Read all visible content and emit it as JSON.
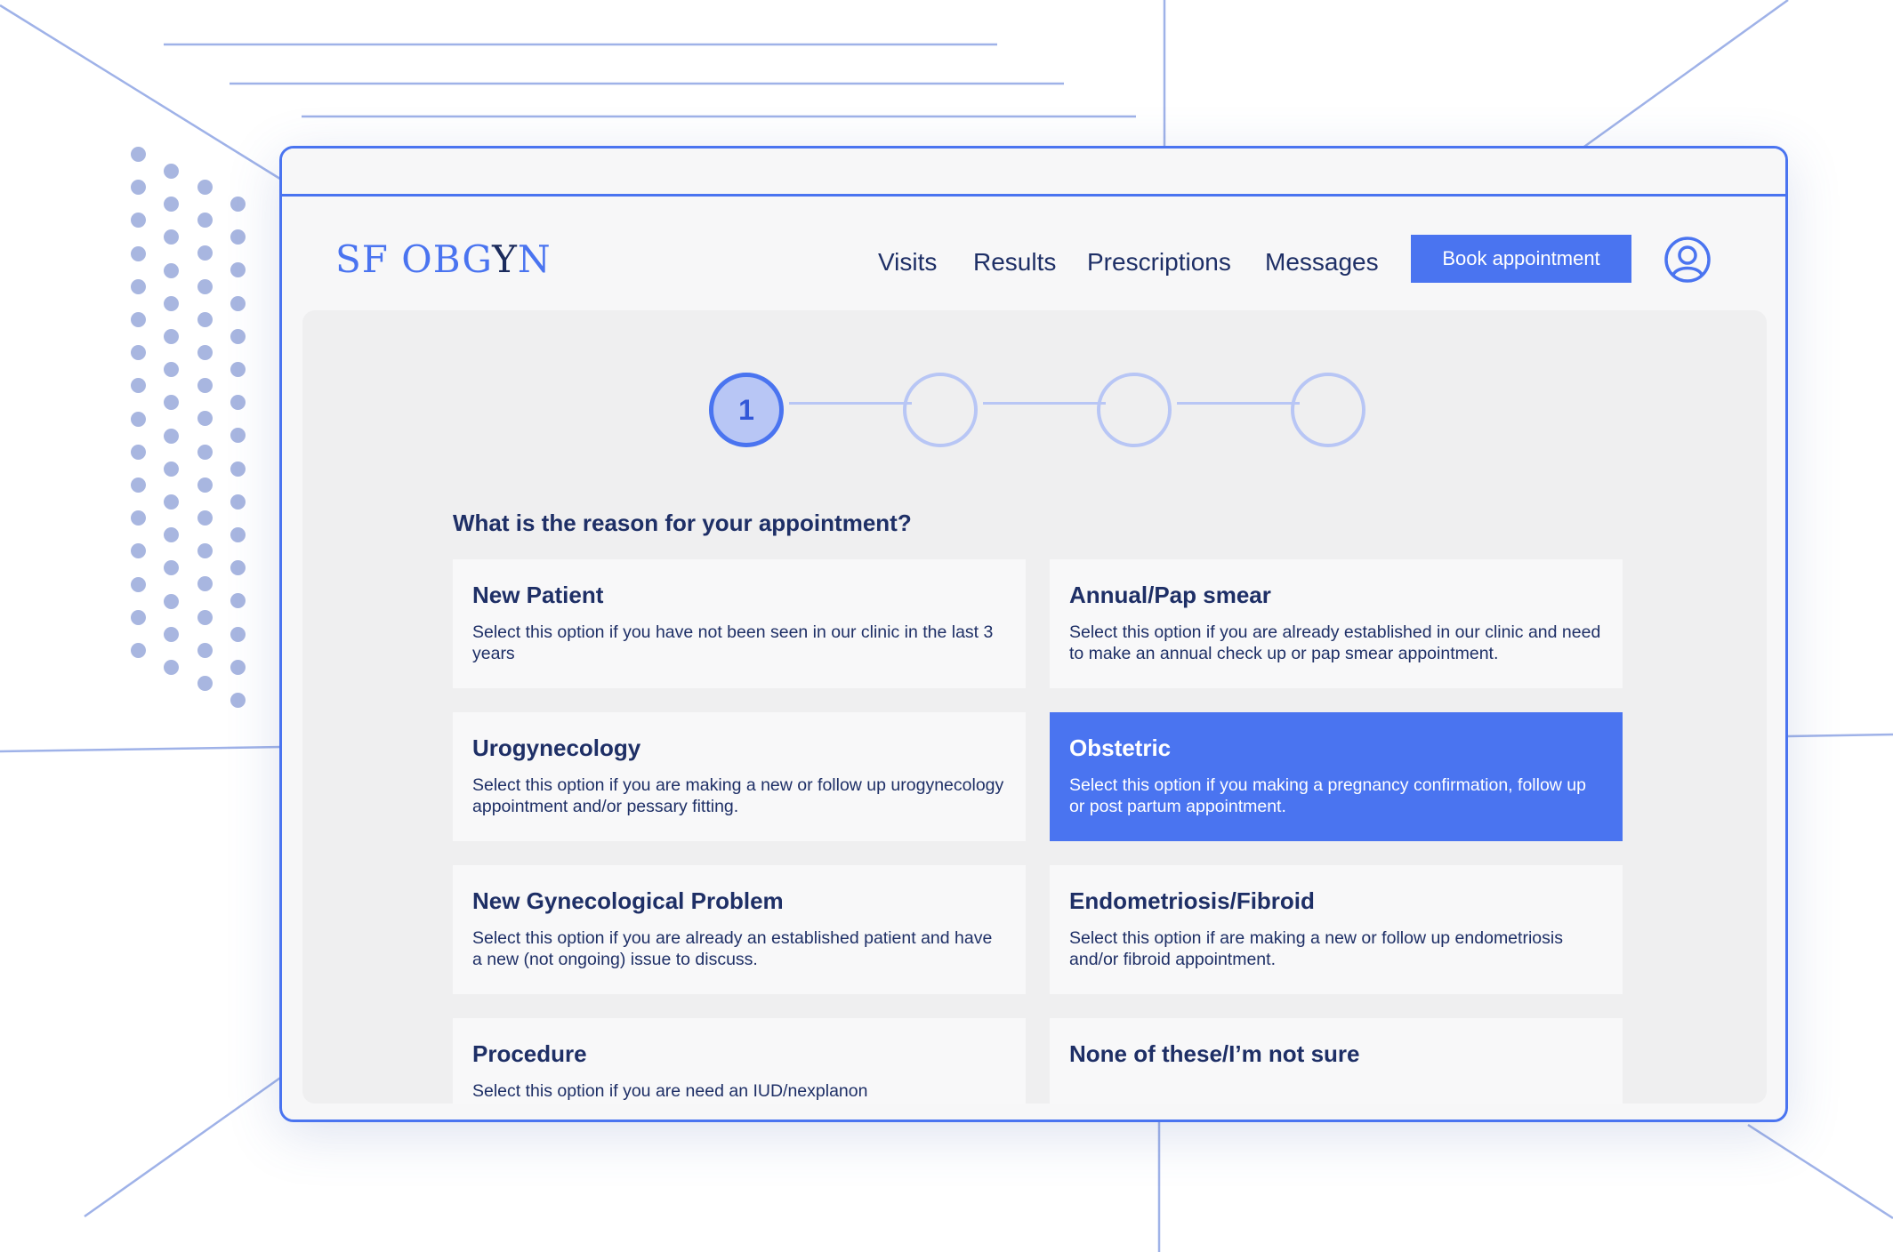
{
  "brand": {
    "logo_prefix": "SF OBG",
    "logo_y": "Y",
    "logo_suffix": "N"
  },
  "nav": {
    "links": [
      "Visits",
      "Results",
      "Prescriptions",
      "Messages"
    ],
    "book_button": "Book appointment",
    "profile_icon": "user-circle-icon"
  },
  "stepper": {
    "current_step": 1,
    "total_steps": 4,
    "current_label": "1"
  },
  "question": "What is the reason for your appointment?",
  "options": [
    {
      "title": "New Patient",
      "description": "Select this option if you have not been seen in our clinic in the last 3 years",
      "selected": false
    },
    {
      "title": "Annual/Pap smear",
      "description": "Select this option if you are already established in our clinic and need to make an annual check up or pap smear appointment.",
      "selected": false
    },
    {
      "title": "Urogynecology",
      "description": "Select this option if you are making a new or follow up urogynecology appointment and/or pessary fitting.",
      "selected": false
    },
    {
      "title": "Obstetric",
      "description": "Select this option if you making a pregnancy confirmation, follow up or post partum appointment.",
      "selected": true
    },
    {
      "title": "New Gynecological Problem",
      "description": "Select this option if you are already an established patient and have a new (not ongoing) issue to discuss.",
      "selected": false
    },
    {
      "title": "Endometriosis/Fibroid",
      "description": "Select this option if are making a new or follow up endometriosis and/or fibroid appointment.",
      "selected": false
    },
    {
      "title": "Procedure",
      "description": "Select this option if you are need an IUD/nexplanon",
      "selected": false
    },
    {
      "title": "None of these/I’m not sure",
      "description": "",
      "selected": false
    }
  ],
  "colors": {
    "accent": "#4a74f0",
    "text": "#1e2f66",
    "step_inactive": "#b8c6f5",
    "panel": "#efeff0"
  }
}
